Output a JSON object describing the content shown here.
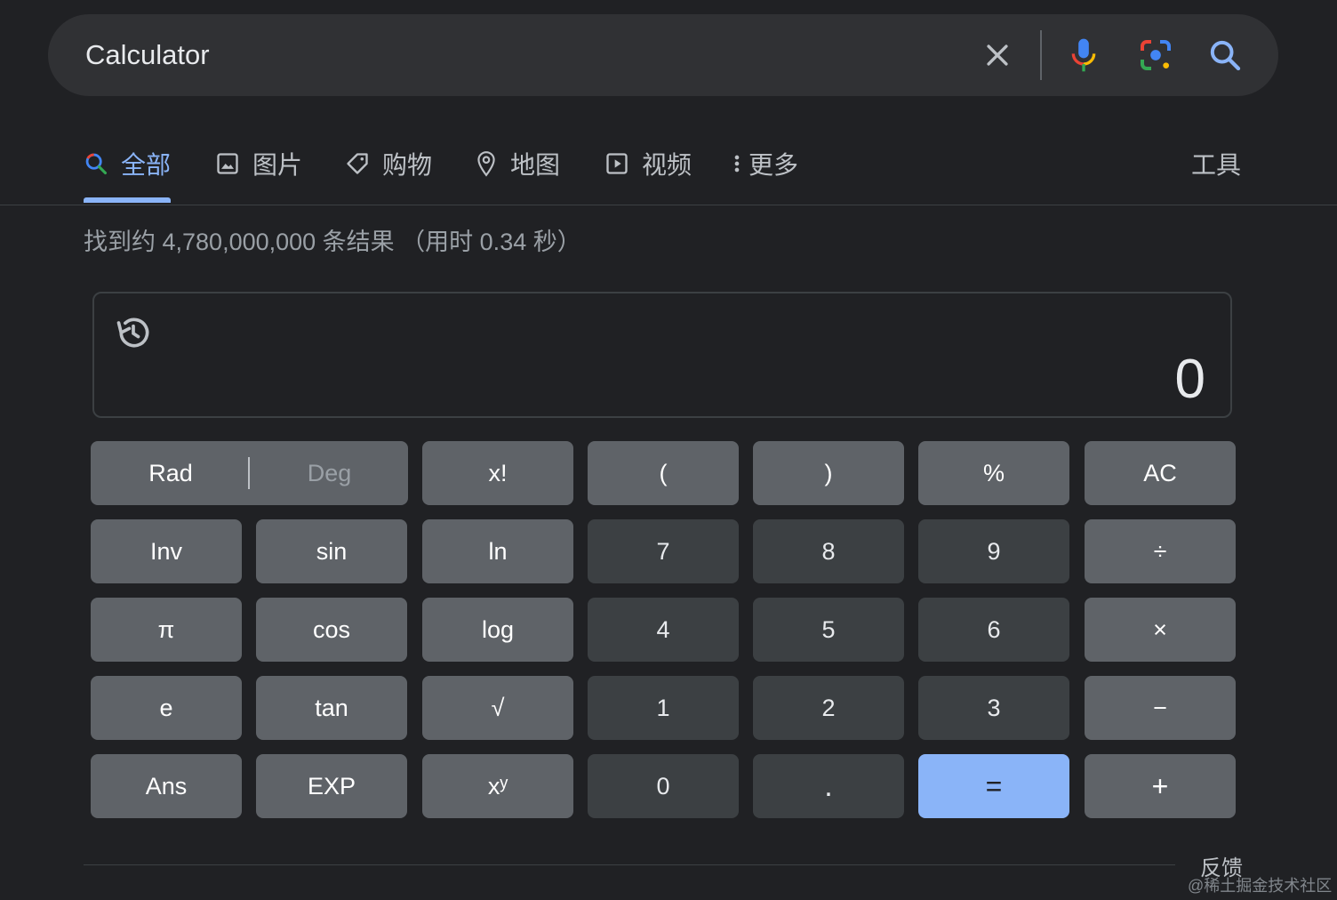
{
  "search": {
    "query": "Calculator"
  },
  "tabs": [
    {
      "label": "全部",
      "icon": "search-icon",
      "active": true
    },
    {
      "label": "图片",
      "icon": "image-icon"
    },
    {
      "label": "购物",
      "icon": "tag-icon"
    },
    {
      "label": "地图",
      "icon": "map-pin-icon"
    },
    {
      "label": "视频",
      "icon": "play-icon"
    },
    {
      "label": "更多",
      "icon": "more-vert-icon"
    }
  ],
  "tools_label": "工具",
  "result_stats": "找到约 4,780,000,000 条结果 （用时 0.34 秒）",
  "calculator": {
    "display_value": "0",
    "rad_label": "Rad",
    "deg_label": "Deg",
    "keys": [
      [
        "x!",
        "(",
        ")",
        "%",
        "AC"
      ],
      [
        "Inv",
        "sin",
        "ln",
        "7",
        "8",
        "9",
        "÷"
      ],
      [
        "π",
        "cos",
        "log",
        "4",
        "5",
        "6",
        "×"
      ],
      [
        "e",
        "tan",
        "√",
        "1",
        "2",
        "3",
        "−"
      ],
      [
        "Ans",
        "EXP",
        "xʸ",
        "0",
        ".",
        "=",
        "+"
      ]
    ]
  },
  "feedback_label": "反馈",
  "watermark": "@稀土掘金技术社区",
  "colors": {
    "background": "#202124",
    "accent": "#8ab4f8",
    "function_key": "#5f6368",
    "number_key": "#3c4043"
  }
}
